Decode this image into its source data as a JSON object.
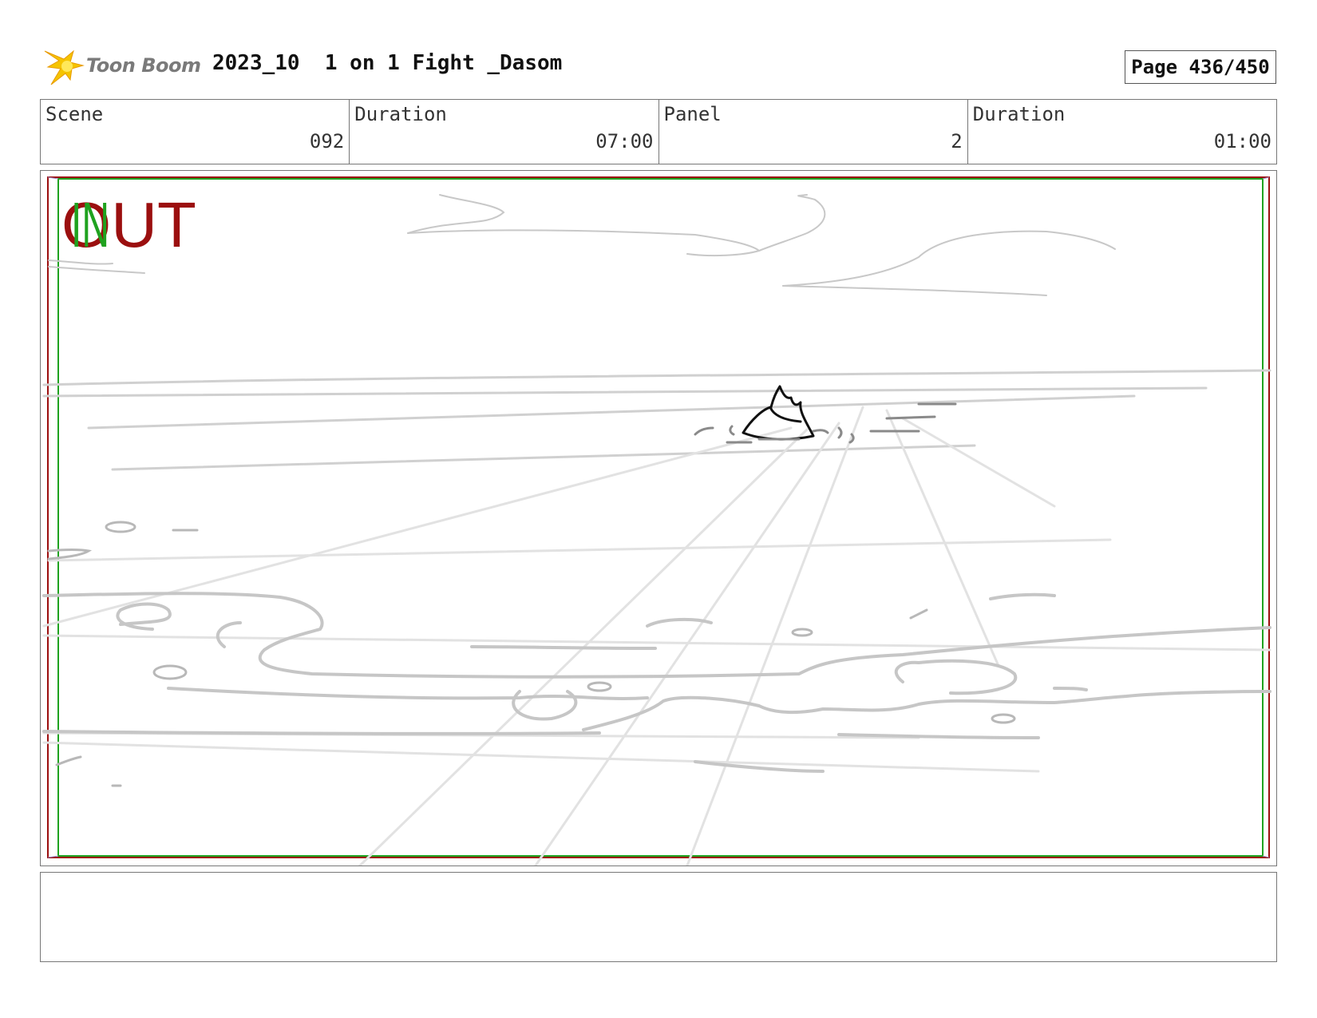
{
  "header": {
    "logo_text": "Toon Boom",
    "project_title": "2023_10  1 on 1 Fight _Dasom",
    "page_label": "Page 436/450"
  },
  "info": {
    "scene_label": "Scene",
    "scene_value": "092",
    "scene_duration_label": "Duration",
    "scene_duration_value": "07:00",
    "panel_label": "Panel",
    "panel_value": "2",
    "panel_duration_label": "Duration",
    "panel_duration_value": "01:00"
  },
  "panel": {
    "in_marker": "IN",
    "out_marker": "OUT",
    "in_color": "#1fa21f",
    "out_color": "#9b0f0f"
  },
  "notes": {
    "text": ""
  }
}
